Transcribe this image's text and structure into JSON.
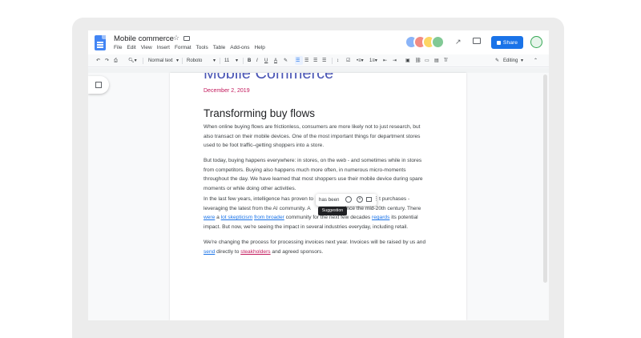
{
  "document": {
    "title": "Mobile commerce",
    "heading": "Mobile Commerce",
    "date": "December 2, 2019",
    "section_title": "Transforming buy flows",
    "paragraphs": [
      "When online buying flows are frictionless, consumers are more likely not to  just research, but also transact on their mobile devices. One of the most important things for department stores used to be foot traffic–getting shoppers into a store.",
      "But today, buying happens everywhere: in stores, on the web - and sometimes while in stores from competitors. Buying also happens much more often, in numerous micro-moments throughout the day. We have learned that most shoppers use their mobile device during spare moments or while doing other activities."
    ],
    "p3": {
      "a": "In the last few years, intelligence has proven to",
      "b": "t purchases - leveraging the latest from the AI community. A",
      "c": "since the mid-20th century. There ",
      "d": "were",
      "e": " a ",
      "f": "lot skepticism",
      "g": " ",
      "h": "from broader",
      "i": " community for the next few decades ",
      "j": "regards",
      "k": " its potential impact. But now, we're seeing the impact in several industries everyday, including retail."
    },
    "p4": {
      "a": "We're changing the process for processing invoices next year. Invoices will be raised by us and ",
      "b": "send",
      "c": " directly to ",
      "d": "steakholders",
      "e": " and agreed sponsors."
    }
  },
  "menus": [
    "File",
    "Edit",
    "View",
    "Insert",
    "Format",
    "Tools",
    "Table",
    "Add-ons",
    "Help"
  ],
  "toolbar": {
    "style": "Normal text",
    "font": "Roboto",
    "size": "11",
    "mode": "Editing"
  },
  "header": {
    "share_label": "Share"
  },
  "suggestion": {
    "text": "has been",
    "tooltip": "Suggestion"
  },
  "colors": {
    "accent": "#1a73e8",
    "heading": "#4a56b5",
    "date": "#c2185b"
  }
}
